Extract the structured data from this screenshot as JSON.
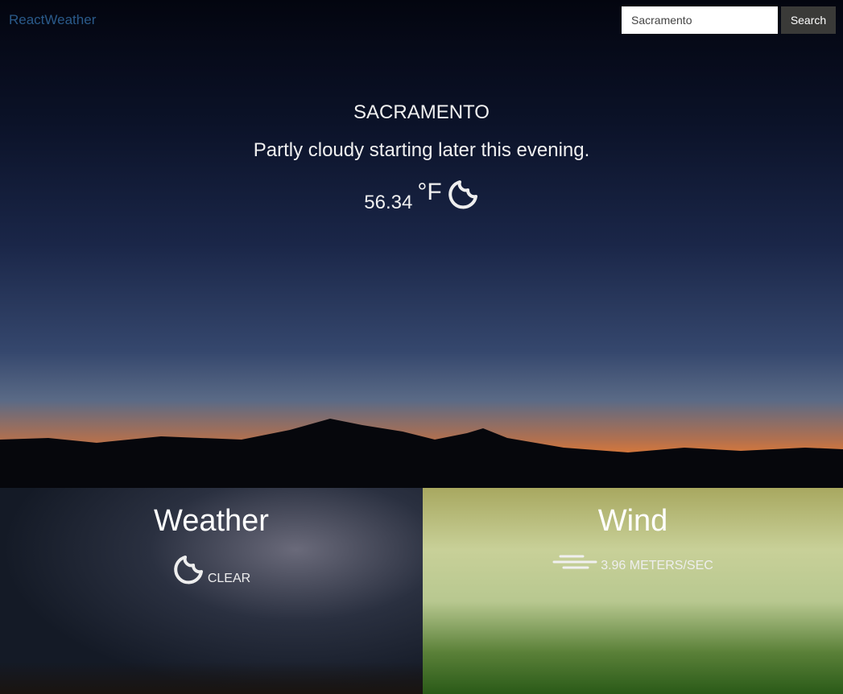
{
  "nav": {
    "brand": "ReactWeather",
    "search_value": "Sacramento",
    "search_button": "Search"
  },
  "current": {
    "city": "SACRAMENTO",
    "summary": "Partly cloudy starting later this evening.",
    "temperature": "56.34",
    "unit": "°F",
    "icon": "moon-icon"
  },
  "weather_panel": {
    "title": "Weather",
    "condition": "CLEAR",
    "icon": "moon-icon"
  },
  "wind_panel": {
    "title": "Wind",
    "speed": "3.96 METERS/SEC",
    "icon": "wind-icon"
  }
}
